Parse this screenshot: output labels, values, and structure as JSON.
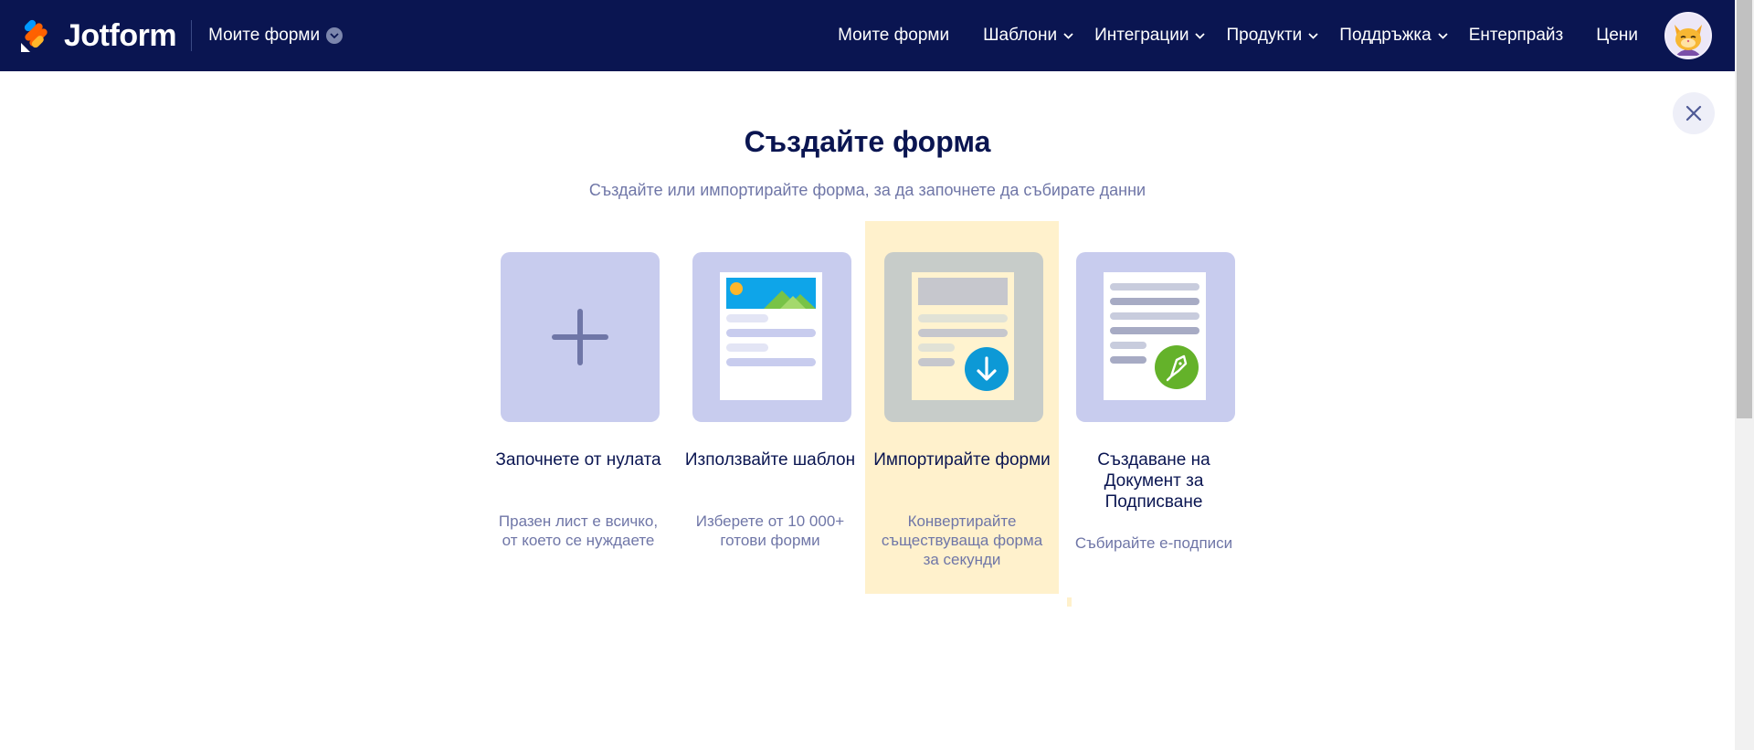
{
  "header": {
    "brand": "Jotform",
    "switch_label": "Моите форми",
    "nav": [
      {
        "label": "Моите форми",
        "has_dropdown": false
      },
      {
        "label": "Шаблони",
        "has_dropdown": true
      },
      {
        "label": "Интеграции",
        "has_dropdown": true
      },
      {
        "label": "Продукти",
        "has_dropdown": true
      },
      {
        "label": "Поддръжка",
        "has_dropdown": true
      },
      {
        "label": "Ентерпрайз",
        "has_dropdown": false
      },
      {
        "label": "Цени",
        "has_dropdown": false
      }
    ]
  },
  "main": {
    "title": "Създайте форма",
    "subtitle": "Създайте или импортирайте форма, за да започнете да събирате данни",
    "cards": [
      {
        "title": "Започнете от нулата",
        "description": "Празен лист е всичко, от което се нуждаете",
        "icon": "plus-icon",
        "highlighted": false
      },
      {
        "title": "Използвайте шаблон",
        "description": "Изберете от 10 000+ готови форми",
        "icon": "template-document-icon",
        "highlighted": false
      },
      {
        "title": "Импортирайте форми",
        "description": "Конвертирайте съществуваща форма за секунди",
        "icon": "import-document-icon",
        "highlighted": true
      },
      {
        "title": "Създаване на Документ за Подписване",
        "description": "Събирайте е-подписи",
        "icon": "sign-document-icon",
        "highlighted": false
      }
    ]
  },
  "colors": {
    "navbar": "#0a1551",
    "tile": "#c8ccee",
    "highlight": "#fff1cc",
    "import_badge": "#0d99d6",
    "sign_badge": "#64b22a"
  }
}
